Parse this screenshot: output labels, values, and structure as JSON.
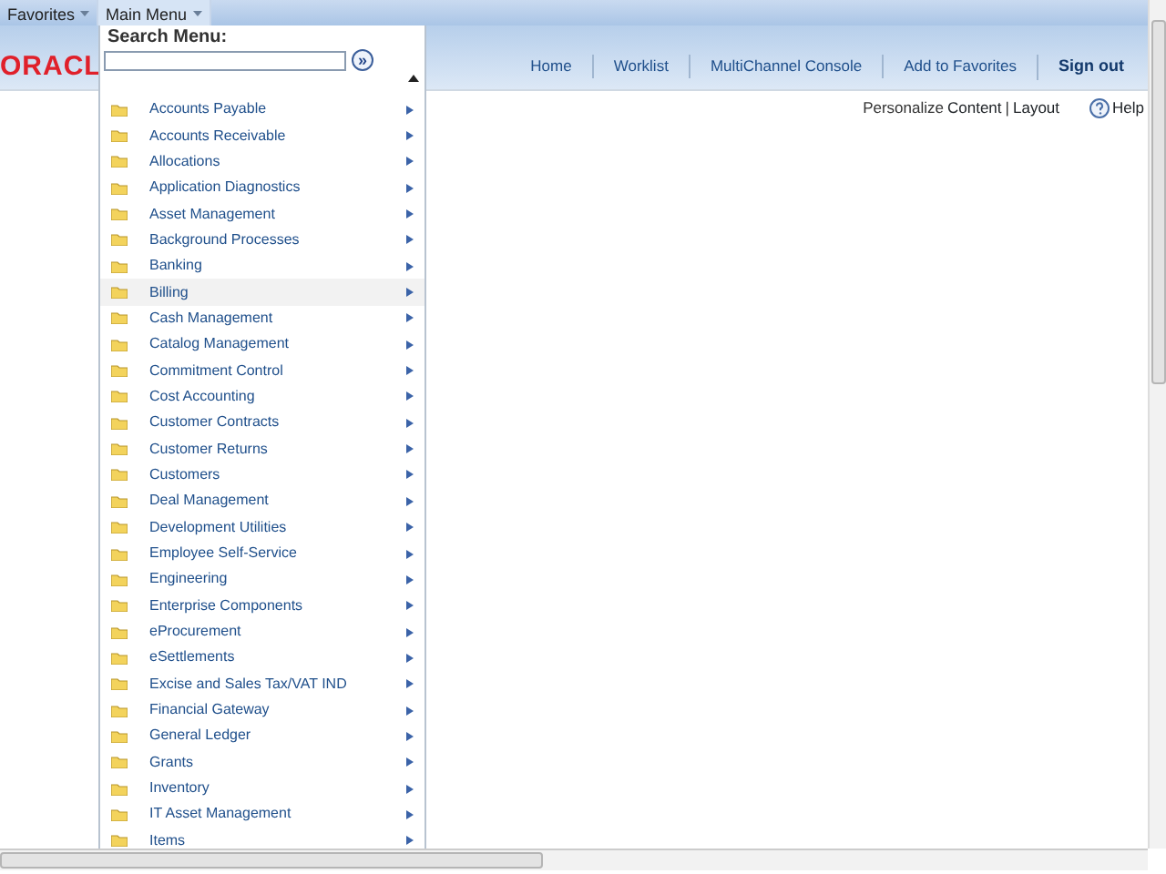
{
  "top_menu": [
    {
      "label": "Favorites",
      "selected": false
    },
    {
      "label": "Main Menu",
      "selected": true
    }
  ],
  "logo": "ORACL",
  "header_links": [
    {
      "label": "Home",
      "bold": false
    },
    {
      "label": "Worklist",
      "bold": false
    },
    {
      "label": "MultiChannel Console",
      "bold": false
    },
    {
      "label": "Add to Favorites",
      "bold": false
    },
    {
      "label": "Sign out",
      "bold": true
    }
  ],
  "page_links": {
    "personalize": "Personalize",
    "content": "Content",
    "separator": "|",
    "layout": "Layout",
    "help": "Help"
  },
  "main_menu": {
    "search_label": "Search Menu:",
    "search_button": "»",
    "items": [
      {
        "label": "Accounts Payable",
        "highlighted": false
      },
      {
        "label": "Accounts Receivable",
        "highlighted": false
      },
      {
        "label": "Allocations",
        "highlighted": false
      },
      {
        "label": "Application Diagnostics",
        "highlighted": false
      },
      {
        "label": "Asset Management",
        "highlighted": false
      },
      {
        "label": "Background Processes",
        "highlighted": false
      },
      {
        "label": "Banking",
        "highlighted": false
      },
      {
        "label": "Billing",
        "highlighted": true
      },
      {
        "label": "Cash Management",
        "highlighted": false
      },
      {
        "label": "Catalog Management",
        "highlighted": false
      },
      {
        "label": "Commitment Control",
        "highlighted": false
      },
      {
        "label": "Cost Accounting",
        "highlighted": false
      },
      {
        "label": "Customer Contracts",
        "highlighted": false
      },
      {
        "label": "Customer Returns",
        "highlighted": false
      },
      {
        "label": "Customers",
        "highlighted": false
      },
      {
        "label": "Deal Management",
        "highlighted": false
      },
      {
        "label": "Development Utilities",
        "highlighted": false
      },
      {
        "label": "Employee Self-Service",
        "highlighted": false
      },
      {
        "label": "Engineering",
        "highlighted": false
      },
      {
        "label": "Enterprise Components",
        "highlighted": false
      },
      {
        "label": "eProcurement",
        "highlighted": false
      },
      {
        "label": "eSettlements",
        "highlighted": false
      },
      {
        "label": "Excise and Sales Tax/VAT IND",
        "highlighted": false
      },
      {
        "label": "Financial Gateway",
        "highlighted": false
      },
      {
        "label": "General Ledger",
        "highlighted": false
      },
      {
        "label": "Grants",
        "highlighted": false
      },
      {
        "label": "Inventory",
        "highlighted": false
      },
      {
        "label": "IT Asset Management",
        "highlighted": false
      },
      {
        "label": "Items",
        "highlighted": false
      }
    ]
  }
}
